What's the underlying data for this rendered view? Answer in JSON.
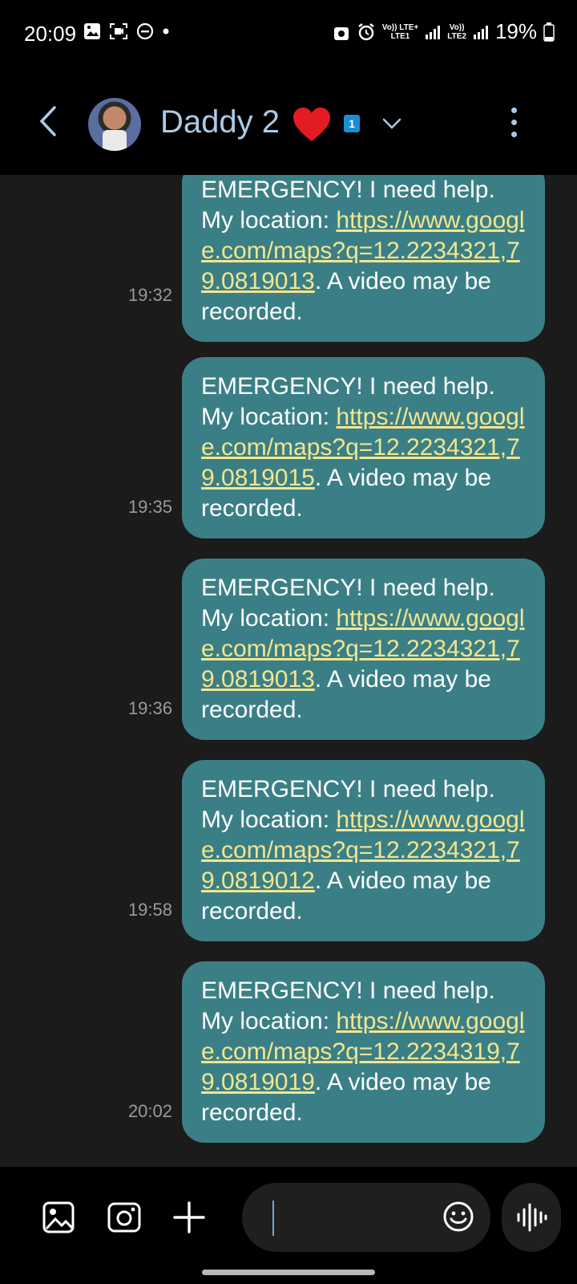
{
  "status_bar": {
    "time": "20:09",
    "sim1_label": "Vo)) LTE+",
    "sim1_sub": "LTE1",
    "sim2_label": "Vo))",
    "sim2_sub": "LTE2",
    "battery": "19%"
  },
  "header": {
    "contact_name": "Daddy 2",
    "sim_badge": "1"
  },
  "messages": [
    {
      "line1": "EMERGENCY! I need help. My location: ",
      "link": "https://www.google.com/maps?q=12.2234321,79.0819013",
      "line2": ". A video may be recorded.",
      "time": "19:32"
    },
    {
      "line1": "EMERGENCY! I need help. My location: ",
      "link": "https://www.google.com/maps?q=12.2234321,79.0819015",
      "line2": ". A video may be recorded.",
      "time": "19:35"
    },
    {
      "line1": "EMERGENCY! I need help. My location: ",
      "link": "https://www.google.com/maps?q=12.2234321,79.0819013",
      "line2": ". A video may be recorded.",
      "time": "19:36"
    },
    {
      "line1": "EMERGENCY! I need help. My location: ",
      "link": "https://www.google.com/maps?q=12.2234321,79.0819012",
      "line2": ". A video may be recorded.",
      "time": "19:58"
    },
    {
      "line1": "EMERGENCY! I need help. My location: ",
      "link": "https://www.google.com/maps?q=12.2234319,79.0819019",
      "line2": ". A video may be recorded.",
      "time": "20:02"
    }
  ],
  "composer": {
    "input_value": ""
  },
  "colors": {
    "bubble": "#3b7f86",
    "link": "#f3e58d",
    "contact_name": "#a9cbe6"
  }
}
